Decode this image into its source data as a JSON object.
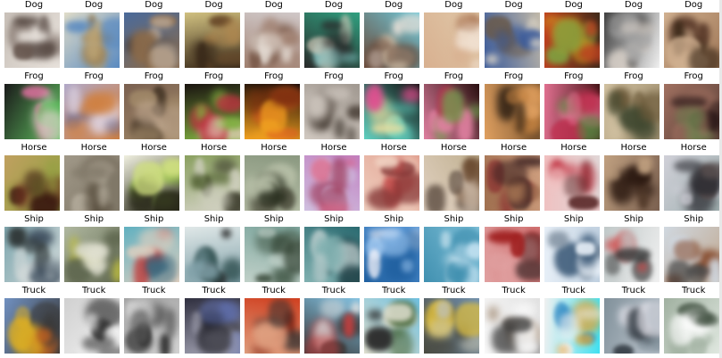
{
  "rows": [
    {
      "class_name": "Dog",
      "labels": [
        "Dog",
        "Dog",
        "Dog",
        "Dog",
        "Dog",
        "Dog",
        "Dog",
        "Dog",
        "Dog",
        "Dog",
        "Dog",
        "Dog"
      ],
      "palettes": [
        [
          "#c8c0b8",
          "#6a5a52",
          "#e8e2dc",
          "#4a3c36"
        ],
        [
          "#e0dcc8",
          "#9a7a48",
          "#5a8ac0",
          "#c0a878"
        ],
        [
          "#4a6a9a",
          "#2a2220",
          "#8a6a4a",
          "#c0b0a0"
        ],
        [
          "#d0c080",
          "#6a4a2a",
          "#3a2a1a",
          "#b08850"
        ],
        [
          "#d0c8c8",
          "#7a5a4a",
          "#a08070",
          "#e8e0d8"
        ],
        [
          "#30a080",
          "#d0c8b8",
          "#2a2a2a",
          "#80c0c0"
        ],
        [
          "#70c8d8",
          "#d8c8b0",
          "#6a4a3a",
          "#e8e0d8"
        ],
        [
          "#e0c8a8",
          "#b08060",
          "#d8b090",
          "#f0e0d0"
        ],
        [
          "#c0b8a8",
          "#6a5a4a",
          "#3a5a9a",
          "#e0d8c8"
        ],
        [
          "#3a2a1a",
          "#d0a020",
          "#c04020",
          "#80a040"
        ],
        [
          "#f0f0f0",
          "#d8d0c8",
          "#404040",
          "#a0a0a0"
        ],
        [
          "#a07858",
          "#5a3a2a",
          "#d0b090",
          "#3a2818"
        ]
      ]
    },
    {
      "class_name": "Frog",
      "labels": [
        "Frog",
        "Frog",
        "Frog",
        "Frog",
        "Frog",
        "Frog",
        "Frog",
        "Frog",
        "Frog",
        "Frog",
        "Frog",
        "Frog"
      ],
      "palettes": [
        [
          "#1a1a1a",
          "#e070a0",
          "#60c060",
          "#d0d0c0"
        ],
        [
          "#b0a8c8",
          "#6a6a90",
          "#d08040",
          "#e0d8e8"
        ],
        [
          "#7a6050",
          "#4a3a2a",
          "#a08868",
          "#c0a890"
        ],
        [
          "#1a1410",
          "#c03040",
          "#80b040",
          "#e8d0c0"
        ],
        [
          "#100808",
          "#e06020",
          "#f0a020",
          "#803010"
        ],
        [
          "#a09890",
          "#605850",
          "#d0c8c0",
          "#4a4038"
        ],
        [
          "#101010",
          "#e05090",
          "#60d0c0",
          "#f0e0a0"
        ],
        [
          "#2a1010",
          "#c03050",
          "#e080a0",
          "#70a050"
        ],
        [
          "#6a4a2a",
          "#c08040",
          "#e0a060",
          "#3a2818"
        ],
        [
          "#3a1010",
          "#c03050",
          "#e07090",
          "#5a8040"
        ],
        [
          "#a09070",
          "#6a5838",
          "#d0c0a0",
          "#404830"
        ],
        [
          "#5a4038",
          "#2a1818",
          "#a07060",
          "#708050"
        ]
      ]
    },
    {
      "class_name": "Horse",
      "labels": [
        "Horse",
        "Horse",
        "Horse",
        "Horse",
        "Horse",
        "Horse",
        "Horse",
        "Horse",
        "Horse",
        "Horse",
        "Horse",
        "Horse"
      ],
      "palettes": [
        [
          "#c0a060",
          "#6a3020",
          "#90a040",
          "#3a1810"
        ],
        [
          "#a09888",
          "#5a5040",
          "#807868",
          "#c8c0b0"
        ],
        [
          "#f0f0e0",
          "#90c040",
          "#2a2a1a",
          "#d0e080"
        ],
        [
          "#8aa060",
          "#3a3a2a",
          "#d0d0c0",
          "#506030"
        ],
        [
          "#8a9880",
          "#4a4a3a",
          "#b8c0a8",
          "#2a3020"
        ],
        [
          "#c080c0",
          "#e06080",
          "#d0c0e0",
          "#a04060"
        ],
        [
          "#e0a090",
          "#c04040",
          "#f0d0c0",
          "#803030"
        ],
        [
          "#c0b090",
          "#6a4a30",
          "#e0d0c0",
          "#3a2a20"
        ],
        [
          "#d0a080",
          "#8a3030",
          "#a07050",
          "#3a2020"
        ],
        [
          "#e0d8d8",
          "#c03040",
          "#f0c0c0",
          "#603030"
        ],
        [
          "#7a6050",
          "#2a1810",
          "#c0a080",
          "#503828"
        ],
        [
          "#a0b0b0",
          "#2a2a30",
          "#d0d0d8",
          "#5a5050"
        ]
      ]
    },
    {
      "class_name": "Ship",
      "labels": [
        "Ship",
        "Ship",
        "Ship",
        "Ship",
        "Ship",
        "Ship",
        "Ship",
        "Ship",
        "Ship",
        "Ship",
        "Ship",
        "Ship"
      ],
      "palettes": [
        [
          "#80a8b0",
          "#405060",
          "#d0d8d8",
          "#2a3030"
        ],
        [
          "#b0b8a0",
          "#c0c040",
          "#606850",
          "#e0e0d0"
        ],
        [
          "#60b0c0",
          "#c03030",
          "#e0d0c0",
          "#3a6a80"
        ],
        [
          "#e0e8e8",
          "#2a4a4a",
          "#80a0a8",
          "#1a1a1a"
        ],
        [
          "#80a8a0",
          "#4a6050",
          "#c0d0c8",
          "#304030"
        ],
        [
          "#2a6a70",
          "#1a3a40",
          "#80b0b0",
          "#c0d0d0"
        ],
        [
          "#60a0e0",
          "#f0f0f8",
          "#2060a0",
          "#a0c8f0"
        ],
        [
          "#80c0d8",
          "#e0f0f8",
          "#4090b0",
          "#c0e0f0"
        ],
        [
          "#d07070",
          "#a02020",
          "#e0a0a0",
          "#5a3a3a"
        ],
        [
          "#c0d0e0",
          "#2a4a6a",
          "#e8f0f8",
          "#8090a0"
        ],
        [
          "#f0f0f0",
          "#d04040",
          "#c0c8c8",
          "#303030"
        ],
        [
          "#c0a890",
          "#804020",
          "#d0d8e0",
          "#4a4a4a"
        ]
      ]
    },
    {
      "class_name": "Truck",
      "labels": [
        "Truck",
        "Truck",
        "Truck",
        "Truck",
        "Truck",
        "Truck",
        "Truck",
        "Truck",
        "Truck",
        "Truck",
        "Truck",
        "Truck"
      ],
      "palettes": [
        [
          "#7090c0",
          "#e0b020",
          "#3a3a3a",
          "#c06020"
        ],
        [
          "#d0d0d0",
          "#2a2a2a",
          "#f0f0f0",
          "#6a6a6a"
        ],
        [
          "#a0a0a0",
          "#2a2a2a",
          "#d0d0d0",
          "#5a5a5a"
        ],
        [
          "#303040",
          "#6070b0",
          "#a0a0b0",
          "#1a1a20"
        ],
        [
          "#d04020",
          "#802010",
          "#e0a080",
          "#303030"
        ],
        [
          "#80c0e0",
          "#e0e0e0",
          "#3a3a3a",
          "#c04040"
        ],
        [
          "#70c0e0",
          "#406030",
          "#e0e0d0",
          "#2a2a2a"
        ],
        [
          "#7090b0",
          "#e0c040",
          "#4a4a40",
          "#c0c0b0"
        ],
        [
          "#e0e0e0",
          "#806040",
          "#f8f8f8",
          "#3a3a3a"
        ],
        [
          "#40e0f0",
          "#2080c0",
          "#f0f0f0",
          "#e0a030"
        ],
        [
          "#c0c8d0",
          "#303840",
          "#80909a",
          "#e0e0e8"
        ],
        [
          "#e0e8e0",
          "#3a4a3a",
          "#a0b0a0",
          "#ffffff"
        ]
      ]
    }
  ]
}
